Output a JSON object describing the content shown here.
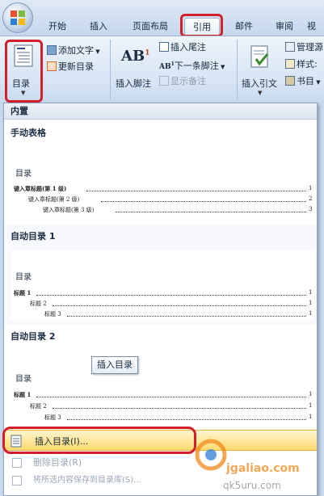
{
  "tabs": [
    "开始",
    "插入",
    "页面布局",
    "引用",
    "邮件",
    "审阅",
    "视"
  ],
  "ribbon": {
    "toc_label": "目录",
    "add_text": "添加文字",
    "update_toc": "更新目录",
    "insert_footnote": "插入脚注",
    "insert_endnote": "插入尾注",
    "next_footnote": "下一条脚注",
    "show_notes": "显示备注",
    "insert_citation": "插入引文",
    "manage_sources": "管理源",
    "style": "样式:",
    "bibliography": "书目"
  },
  "dropdown": {
    "builtin": "内置",
    "manual_table": "手动表格",
    "auto_toc_1": "自动目录 1",
    "auto_toc_2": "自动目录 2",
    "preview_title": "目录",
    "manual_entries": [
      "键入章标题(第 1 级)",
      "键入章标题(第 2 级)",
      "键入章标题(第 3 级)"
    ],
    "auto1_entries": [
      "标题 1",
      "标题 2",
      "标题 3"
    ],
    "auto2_entries": [
      "标题 1",
      "标题 2",
      "标题 3"
    ],
    "page_num": "1",
    "manual_nums": [
      "1",
      "2",
      "3"
    ],
    "insert_toc": "插入目录(I)...",
    "remove_toc": "删除目录(R)",
    "save_selection": "将所选内容保存到目录库(S)...",
    "tooltip": "插入目录"
  },
  "watermark": {
    "site": "jgaliao.com",
    "site2": "qk5uru.com"
  },
  "colors": {
    "highlight": "#d31f2b",
    "accent": "#ffdb6e"
  }
}
